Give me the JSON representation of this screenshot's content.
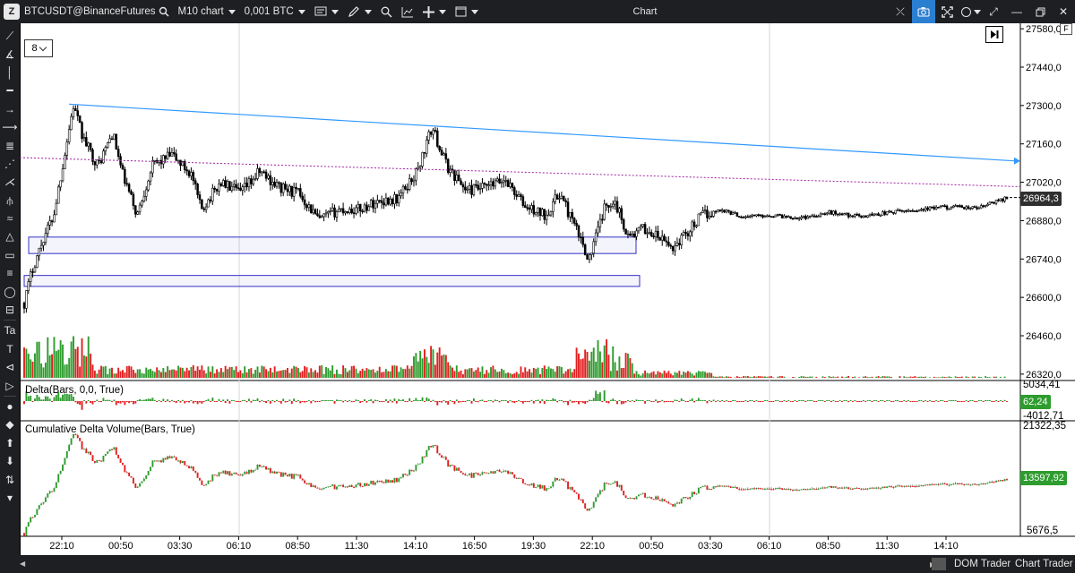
{
  "titlebar": {
    "instrument": "BTCUSDT@BinanceFutures",
    "chart_type": "M10 chart",
    "quantity": "0,001 BTC",
    "window_title": "Chart"
  },
  "period_selector": {
    "value": "8"
  },
  "corner_button": "F",
  "price_axis": {
    "ticks": [
      "27580,0",
      "27440,0",
      "27300,0",
      "27160,0",
      "27020,0",
      "26880,0",
      "26740,0",
      "26600,0",
      "26460,0",
      "26320,0"
    ],
    "tick_values": [
      27580,
      27440,
      27300,
      27160,
      27020,
      26880,
      26740,
      26600,
      26460,
      26320
    ],
    "last_price": "26964,3",
    "last_price_value": 26964.3
  },
  "time_axis": {
    "labels": [
      "22:10",
      "00:50",
      "03:30",
      "06:10",
      "08:50",
      "11:30",
      "14:10",
      "16:50",
      "19:30",
      "22:10",
      "00:50",
      "03:30",
      "06:10",
      "08:50",
      "11:30",
      "14:10"
    ]
  },
  "delta_panel": {
    "title": "Delta(Bars, 0,0, True)",
    "max": "5034,41",
    "min": "-4012,71",
    "current": "62,24"
  },
  "cdv_panel": {
    "title": "Cumulative Delta Volume(Bars, True)",
    "max": "21322,35",
    "min": "5676,5",
    "current": "13597,92"
  },
  "bottombar": {
    "dom_trader": "DOM Trader",
    "chart_trader": "Chart Trader"
  },
  "colors": {
    "background_dark": "#1d1f22",
    "up_candle": "#ffffff",
    "down_candle": "#000000",
    "volume_up": "#2e9c2e",
    "volume_down": "#e02020",
    "trendline": "#3399ff",
    "dotted_line": "#a020a0",
    "zones": "#3030c8",
    "price_tag": "#2f2f2f",
    "cdv_tag": "#2e9c2e"
  },
  "chart_data": {
    "type": "candlestick",
    "x_labels": [
      "22:10",
      "00:50",
      "03:30",
      "06:10",
      "08:50",
      "11:30",
      "14:10",
      "16:50",
      "19:30",
      "22:10",
      "00:50",
      "03:30",
      "06:10",
      "08:50",
      "11:30",
      "14:10"
    ],
    "ylim": [
      26300,
      27600
    ],
    "last_price": 26964.3,
    "trendline": {
      "start_price": 27305,
      "end_price": 27098
    },
    "dotted_level": {
      "start_price": 27110,
      "end_price": 27004
    },
    "zones": [
      {
        "top": 26820,
        "bottom": 26760
      },
      {
        "top": 26680,
        "bottom": 26640
      }
    ],
    "key_path": [
      [
        0,
        26580
      ],
      [
        0.008,
        26700
      ],
      [
        0.02,
        26820
      ],
      [
        0.03,
        26900
      ],
      [
        0.04,
        27100
      ],
      [
        0.05,
        27300
      ],
      [
        0.06,
        27180
      ],
      [
        0.075,
        27080
      ],
      [
        0.09,
        27200
      ],
      [
        0.1,
        27050
      ],
      [
        0.115,
        26900
      ],
      [
        0.13,
        27080
      ],
      [
        0.15,
        27120
      ],
      [
        0.17,
        27050
      ],
      [
        0.18,
        26920
      ],
      [
        0.2,
        27020
      ],
      [
        0.22,
        26980
      ],
      [
        0.24,
        27060
      ],
      [
        0.26,
        27000
      ],
      [
        0.28,
        26980
      ],
      [
        0.3,
        26880
      ],
      [
        0.32,
        26920
      ],
      [
        0.34,
        26920
      ],
      [
        0.36,
        26950
      ],
      [
        0.38,
        26960
      ],
      [
        0.4,
        27060
      ],
      [
        0.415,
        27220
      ],
      [
        0.43,
        27080
      ],
      [
        0.45,
        26990
      ],
      [
        0.47,
        27000
      ],
      [
        0.49,
        27030
      ],
      [
        0.51,
        26930
      ],
      [
        0.53,
        26900
      ],
      [
        0.545,
        26980
      ],
      [
        0.56,
        26860
      ],
      [
        0.575,
        26740
      ],
      [
        0.59,
        26920
      ],
      [
        0.6,
        26960
      ],
      [
        0.615,
        26820
      ],
      [
        0.63,
        26850
      ],
      [
        0.645,
        26820
      ],
      [
        0.66,
        26780
      ],
      [
        0.675,
        26840
      ],
      [
        0.69,
        26900
      ],
      [
        0.71,
        26920
      ],
      [
        0.73,
        26895
      ],
      [
        0.76,
        26900
      ],
      [
        0.79,
        26890
      ],
      [
        0.82,
        26910
      ],
      [
        0.85,
        26895
      ],
      [
        0.88,
        26910
      ],
      [
        0.91,
        26920
      ],
      [
        0.94,
        26930
      ],
      [
        0.97,
        26925
      ],
      [
        1.0,
        26964
      ]
    ]
  }
}
